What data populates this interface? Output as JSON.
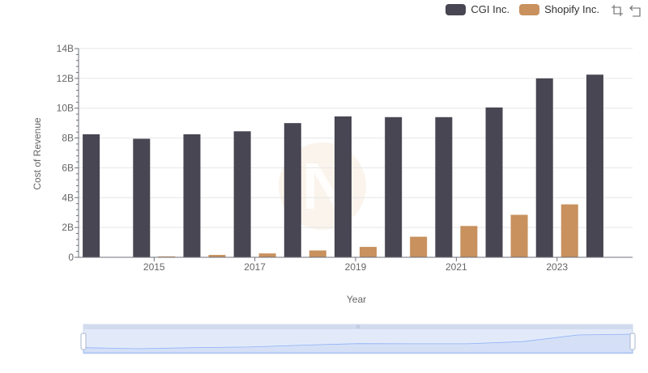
{
  "chart_data": {
    "type": "bar",
    "categories": [
      "2014",
      "2015",
      "2016",
      "2017",
      "2018",
      "2019",
      "2020",
      "2021",
      "2022",
      "2023",
      "2024"
    ],
    "x_tick_labels": [
      "2015",
      "2017",
      "2019",
      "2021",
      "2023"
    ],
    "series": [
      {
        "name": "CGI Inc.",
        "color": "#484652",
        "values": [
          8.25,
          7.95,
          8.25,
          8.45,
          9.0,
          9.45,
          9.4,
          9.4,
          10.05,
          12.0,
          12.25
        ]
      },
      {
        "name": "Shopify Inc.",
        "color": "#c8915e",
        "values": [
          null,
          0.06,
          0.16,
          0.26,
          0.46,
          0.7,
          1.38,
          2.1,
          2.85,
          3.55,
          null
        ]
      }
    ],
    "ylim": [
      0,
      14
    ],
    "y_ticks": [
      0,
      2,
      4,
      6,
      8,
      10,
      12,
      14
    ],
    "y_tick_labels": [
      "0",
      "2B",
      "4B",
      "6B",
      "8B",
      "10B",
      "12B",
      "14B"
    ],
    "xlabel": "Year",
    "ylabel": "Cost of Revenue",
    "grid": true,
    "legend_position": "top-right"
  },
  "toolbox": {
    "zoom_icon": "zoom-select-icon",
    "reset_icon": "zoom-reset-icon"
  },
  "datazoom": {
    "handle_label": "III"
  }
}
